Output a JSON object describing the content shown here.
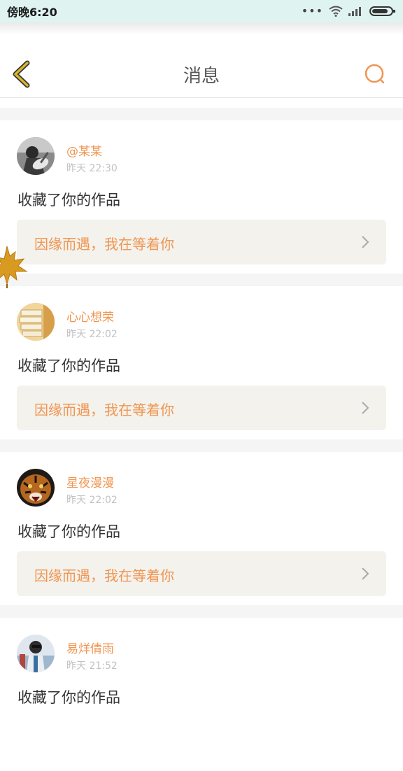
{
  "statusbar": {
    "time": "傍晚6:20",
    "dots": "•••"
  },
  "nav": {
    "title": "消息"
  },
  "messages": [
    {
      "user": "@某某",
      "time": "昨天 22:30",
      "action": "收藏了你的作品",
      "work": "因缘而遇，我在等着你",
      "avatar_icon": "avatar-guitar"
    },
    {
      "user": "心心想荣",
      "time": "昨天 22:02",
      "action": "收藏了你的作品",
      "work": "因缘而遇，我在等着你",
      "avatar_icon": "avatar-books"
    },
    {
      "user": "星夜漫漫",
      "time": "昨天 22:02",
      "action": "收藏了你的作品",
      "work": "因缘而遇，我在等着你",
      "avatar_icon": "avatar-tiger"
    },
    {
      "user": "易烊倩雨",
      "time": "昨天 21:52",
      "action": "收藏了你的作品",
      "work": "",
      "avatar_icon": "avatar-person"
    }
  ],
  "colors": {
    "accent": "#f09550",
    "back_icon": "#d9b52a",
    "card_bg": "#f3f2ed"
  }
}
